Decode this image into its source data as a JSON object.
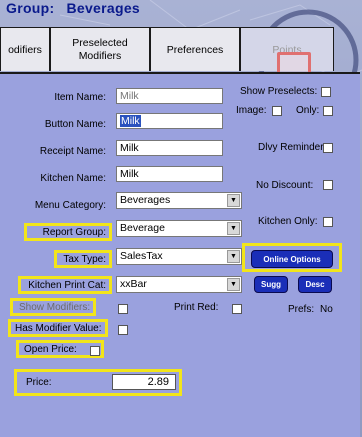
{
  "header": {
    "group_label": "Group:",
    "group_value": "Beverages"
  },
  "tabs": [
    {
      "label": "odifiers"
    },
    {
      "label": "Preselected\nModifiers"
    },
    {
      "label": "Preferences"
    },
    {
      "label": "Points"
    }
  ],
  "form": {
    "item_name": {
      "label": "Item Name:",
      "value": "Milk"
    },
    "button_name": {
      "label": "Button Name:",
      "value": "Milk"
    },
    "receipt_name": {
      "label": "Receipt Name:",
      "value": "Milk"
    },
    "kitchen_name": {
      "label": "Kitchen Name:",
      "value": "Milk"
    },
    "menu_category": {
      "label": "Menu Category:",
      "value": "Beverages"
    },
    "report_group": {
      "label": "Report Group:",
      "value": "Beverage"
    },
    "tax_type": {
      "label": "Tax Type:",
      "value": "SalesTax"
    },
    "kitchen_print_cat": {
      "label": "Kitchen Print Cat:",
      "value": "xxBar"
    },
    "show_modifiers": {
      "label": "Show Modifiers:"
    },
    "has_modifier_value": {
      "label": "Has Modifier Value:"
    },
    "open_price": {
      "label": "Open Price:"
    },
    "price": {
      "label": "Price:",
      "value": "2.89"
    },
    "print_red": {
      "label": "Print Red:"
    },
    "prefs": {
      "label": "Prefs:",
      "value": "No"
    }
  },
  "right": {
    "show_preselects": "Show Preselects:",
    "image": "Image:",
    "only": "Only:",
    "dlvy_reminder": "Dlvy Reminder:",
    "no_discount": "No Discount:",
    "kitchen_only": "Kitchen Only:"
  },
  "buttons": {
    "online_options": "Online Options",
    "sugg": "Sugg",
    "desc": "Desc"
  },
  "colors": {
    "highlight": "#f2e51a",
    "button": "#1a2eb8",
    "panel": "#9aa1de",
    "title": "#0a1a8c"
  }
}
